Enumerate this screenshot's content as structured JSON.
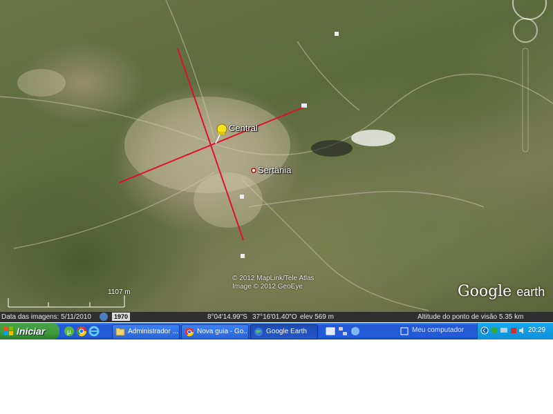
{
  "map": {
    "places": [
      {
        "name": "Central",
        "marker": "yellow-pushpin"
      },
      {
        "name": "Sertânia",
        "marker": "city-dot"
      }
    ],
    "copyright_lines": [
      "© 2012 MapLink/Tele Atlas",
      "Image © 2012 GeoEye"
    ],
    "scale_label": "1107 m",
    "logo_google": "Google",
    "logo_earth": "earth",
    "line_color": "#e0102a"
  },
  "status": {
    "imagery_date": "Data das imagens: 5/11/2010",
    "history_year": "1970",
    "latitude": "8°04'14.99\"S",
    "longitude": "37°16'01.40\"O",
    "elevation": "elev  569 m",
    "eye_altitude": "Altitude do ponto de visão   5.35 km"
  },
  "taskbar": {
    "start_label": "Iniciar",
    "quick_launch": [
      "utorrent-icon",
      "chrome-icon",
      "ie-icon"
    ],
    "tasks": [
      {
        "label": "Administrador ...",
        "icon": "folder-icon",
        "active": false
      },
      {
        "label": "Nova guia - Go...",
        "icon": "chrome-icon",
        "active": false
      },
      {
        "label": "Google Earth",
        "icon": "google-earth-icon",
        "active": true
      }
    ],
    "my_computer_label": "Meu computador",
    "clock": "20:29"
  }
}
